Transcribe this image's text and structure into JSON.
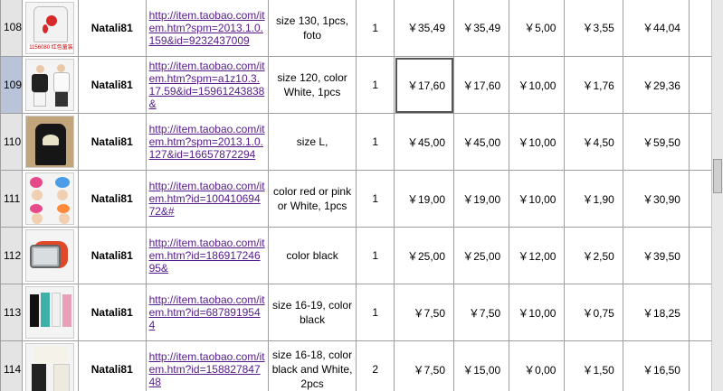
{
  "rows": [
    {
      "row_num": "108",
      "thumb": "shirt-with-flower-icon",
      "thumb_caption": "1156080 红色童装",
      "seller": "Natali81",
      "link": "http://item.taobao.com/item.htm?spm=2013.1.0.159&id=9232437009",
      "desc": "size 130, 1pcs, foto",
      "qty": "1",
      "unit_price": "￥35,49",
      "total": "￥35,49",
      "shipping": "￥5,00",
      "fee": "￥3,55",
      "sum": "￥44,04"
    },
    {
      "row_num": "109",
      "thumb": "kids-outfit-icon",
      "seller": "Natali81",
      "link": "http://item.taobao.com/item.htm?spm=a1z10.3.17.59&id=15961243838&",
      "desc": "size 120, color White, 1pcs",
      "qty": "1",
      "unit_price": "￥17,60",
      "total": "￥17,60",
      "shipping": "￥10,00",
      "fee": "￥1,76",
      "sum": "￥29,36"
    },
    {
      "row_num": "110",
      "thumb": "black-shirt-icon",
      "seller": "Natali81",
      "link": "http://item.taobao.com/item.htm?spm=2013.1.0.127&id=16657872294",
      "desc": "size L,",
      "qty": "1",
      "unit_price": "￥45,00",
      "total": "￥45,00",
      "shipping": "￥10,00",
      "fee": "￥4,50",
      "sum": "￥59,50"
    },
    {
      "row_num": "111",
      "thumb": "hair-accessories-icon",
      "seller": "Natali81",
      "link": "http://item.taobao.com/item.htm?id=10041069472&#",
      "desc": "color red or pink or White, 1pcs",
      "qty": "1",
      "unit_price": "￥19,00",
      "total": "￥19,00",
      "shipping": "￥10,00",
      "fee": "￥1,90",
      "sum": "￥30,90"
    },
    {
      "row_num": "112",
      "thumb": "watch-icon",
      "seller": "Natali81",
      "link": "http://item.taobao.com/item.htm?id=18691724695&",
      "desc": "color black",
      "qty": "1",
      "unit_price": "￥25,00",
      "total": "￥25,00",
      "shipping": "￥12,00",
      "fee": "￥2,50",
      "sum": "￥39,50"
    },
    {
      "row_num": "113",
      "thumb": "socks-icon",
      "seller": "Natali81",
      "link": "http://item.taobao.com/item.htm?id=6878919544",
      "desc": "size 16-19, color black",
      "qty": "1",
      "unit_price": "￥7,50",
      "total": "￥7,50",
      "shipping": "￥10,00",
      "fee": "￥0,75",
      "sum": "￥18,25"
    },
    {
      "row_num": "114",
      "thumb": "tights-icon",
      "seller": "Natali81",
      "link": "http://item.taobao.com/item.htm?id=15882784748",
      "desc": "size 16-18, color black and White, 2pcs",
      "qty": "2",
      "unit_price": "￥7,50",
      "total": "￥15,00",
      "shipping": "￥0,00",
      "fee": "￥1,50",
      "sum": "￥16,50"
    }
  ],
  "colors": {
    "link": "#551a8b",
    "header_bg": "#e4e4e4",
    "active_header_bg": "#b9c4da",
    "grid": "#9e9e9e"
  }
}
